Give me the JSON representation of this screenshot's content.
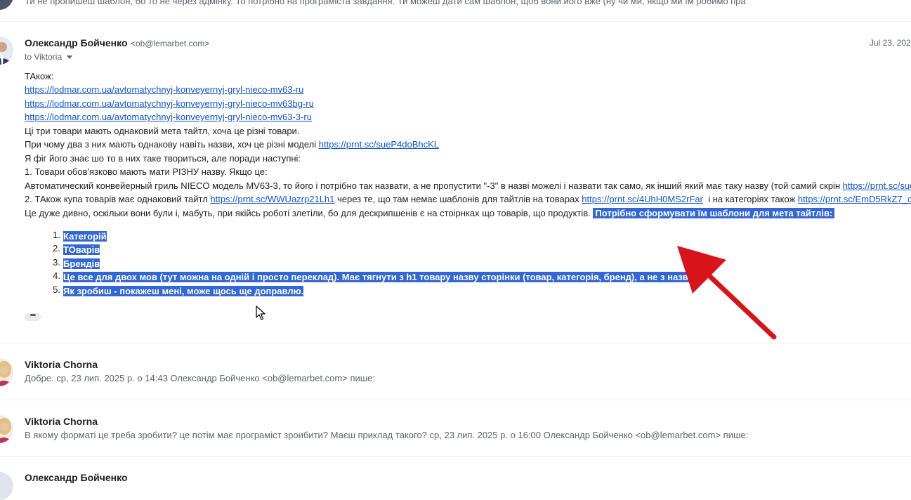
{
  "top_snippet": "Ти не пропишеш шаблон, бо то не через адмінку. То потрібно на програміста завдання. Ти можеш дати сам шаблон, щоб вони його вже (ну чи ми, якщо ми їм робимо пра",
  "message1": {
    "sender": "Олександр Бойченко",
    "email": "<ob@lemarbet.com>",
    "to_label": "to Viktoria",
    "date": "Jul 23, 202",
    "lines": {
      "l1": "ТАкож:",
      "link1": "https://lodmar.com.ua/avtomatychnyj-konveyernyj-gryl-nieco-mv63-ru",
      "link2": "https://lodmar.com.ua/avtomatychnyj-konveyernyj-gryl-nieco-mv63bg-ru",
      "link3": "https://lodmar.com.ua/avtomatychnyj-konveyernyj-gryl-nieco-mv63-3-ru",
      "l5": "Ці три товари мають однаковий мета тайтл, хоча це різні товари.",
      "l6_text": "При чому два з них мають однакову навіть назви, хоч це різні моделі ",
      "l6_link": "https://prnt.sc/sueP4doBhcKL",
      "l7": "Я фіг його знає шо то в них таке твориться, але поради наступні:",
      "l8": "1. Товари обов'язково мають мати РІЗНУ назву. Якщо це:",
      "l9_text": "Автоматический конвейерный гриль NIECO модель MV63-3, то його і потрібно так назвати, а не пропустити \"-3\" в назві можелі і назвати так само, як інший який має таку назву (той самий скрін ",
      "l9_link": "https://prnt.sc/sue",
      "l10_a": "2. ТАкож купа товарів має однаковий тайтл ",
      "l10_link1": "https://prnt.sc/WWUazrp21Lh1",
      "l10_b": " через те, що там немає шаблонів для тайтлів на товарах ",
      "l10_link2": "https://prnt.sc/4UhH0MS2rFar",
      "l10_c": "  і на категоріях також ",
      "l10_link3": "https://prnt.sc/EmD5RkZ7_c",
      "l11_text": "Це дуже дивно, оскільки вони були і, мабуть, при якійсь роботі злетіли, бо для дескрипшенів є на стоірнках що товарів, що продуктів. ",
      "l11_highlight": "Потрібно сформувати їм шаблони для мета тайтлів:"
    },
    "list": [
      {
        "num": "1.",
        "text": "Категорій"
      },
      {
        "num": "2.",
        "text": "ТОварів"
      },
      {
        "num": "3.",
        "text": "Брендів"
      },
      {
        "num": "4.",
        "text": "Це все для двох мов (тут можна на одній і просто переклад). Має тягнути з h1 товару назву сторінки (товар, категорія, бренд), а не з назви."
      },
      {
        "num": "5.",
        "text": "Як зробиш - покажеш мені, може щось ще доправлю."
      }
    ],
    "more_label": "•••"
  },
  "message2": {
    "sender": "Viktoria Chorna",
    "snippet": "Добре. ср, 23 лип. 2025 р. о 14:43 Олександр Бойченко <ob@lemarbet.com> пише:"
  },
  "message3": {
    "sender": "Viktoria Chorna",
    "snippet": "В якому форматі це треба зробити? це потім має програміст зроибити? Маєш приклад такого? ср, 23 лип. 2025 р. о 16:00 Олександр Бойченко <ob@lemarbet.com> пише:"
  },
  "message4": {
    "sender": "Олександр Бойченко"
  },
  "colors": {
    "link": "#1155cc",
    "highlight": "#3367d6",
    "arrow": "#d7141a"
  }
}
